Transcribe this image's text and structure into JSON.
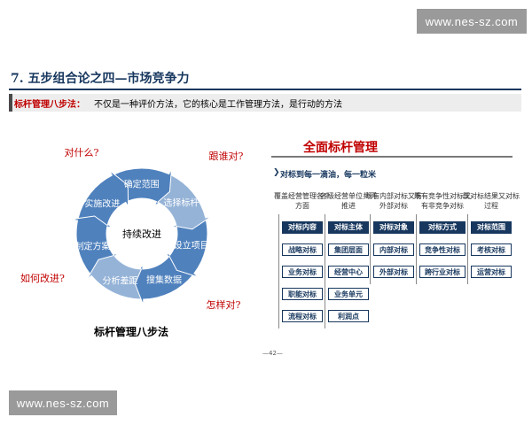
{
  "watermark": "www.nes-sz.com",
  "title": "7. 五步组合论之四—市场竞争力",
  "definition": {
    "label": "标杆管理八步法：",
    "text": "不仅是一种评价方法，它的核心是工作管理方法，是行动的方法"
  },
  "cycle": {
    "center": "持续改进",
    "steps": [
      "确定范围",
      "选择标杆",
      "设立项目",
      "搜集数据",
      "分析差距",
      "制定方案",
      "实施改进"
    ],
    "questions": [
      "对什么?",
      "跟谁对?",
      "怎样对?",
      "如何改进?"
    ],
    "caption": "标杆管理八步法"
  },
  "right": {
    "title": "全面标杆管理",
    "subtitle": "对标到每一滴油，每一粒米",
    "columns": [
      {
        "header": "覆盖经营管理各个方面",
        "items": [
          {
            "label": "对标内容",
            "dark": true
          },
          {
            "label": "战略对标",
            "dark": false
          },
          {
            "label": "业务对标",
            "dark": false
          },
          {
            "label": "职能对标",
            "dark": false
          },
          {
            "label": "流程对标",
            "dark": false
          }
        ]
      },
      {
        "header": "各级经营单位共同推进",
        "items": [
          {
            "label": "对标主体",
            "dark": true
          },
          {
            "label": "集团层面",
            "dark": false
          },
          {
            "label": "经营中心",
            "dark": false
          },
          {
            "label": "业务单元",
            "dark": false
          },
          {
            "label": "利润点",
            "dark": false
          }
        ]
      },
      {
        "header": "既有内部对标又有外部对标",
        "items": [
          {
            "label": "对标对象",
            "dark": true
          },
          {
            "label": "内部对标",
            "dark": false
          },
          {
            "label": "外部对标",
            "dark": false
          }
        ]
      },
      {
        "header": "既有竞争性对标又有非竞争对标",
        "items": [
          {
            "label": "对标方式",
            "dark": true
          },
          {
            "label": "竞争性对标",
            "dark": false
          },
          {
            "label": "跨行业对标",
            "dark": false
          }
        ]
      },
      {
        "header": "既对标结果又对标过程",
        "items": [
          {
            "label": "对标范围",
            "dark": true
          },
          {
            "label": "考核对标",
            "dark": false
          },
          {
            "label": "运营对标",
            "dark": false
          }
        ]
      }
    ]
  },
  "page_number": "—42—",
  "colors": {
    "accent_red": "#c00000",
    "navy": "#17375e",
    "cycle_blue": "#4f81bd",
    "cycle_light": "#95b3d7"
  }
}
